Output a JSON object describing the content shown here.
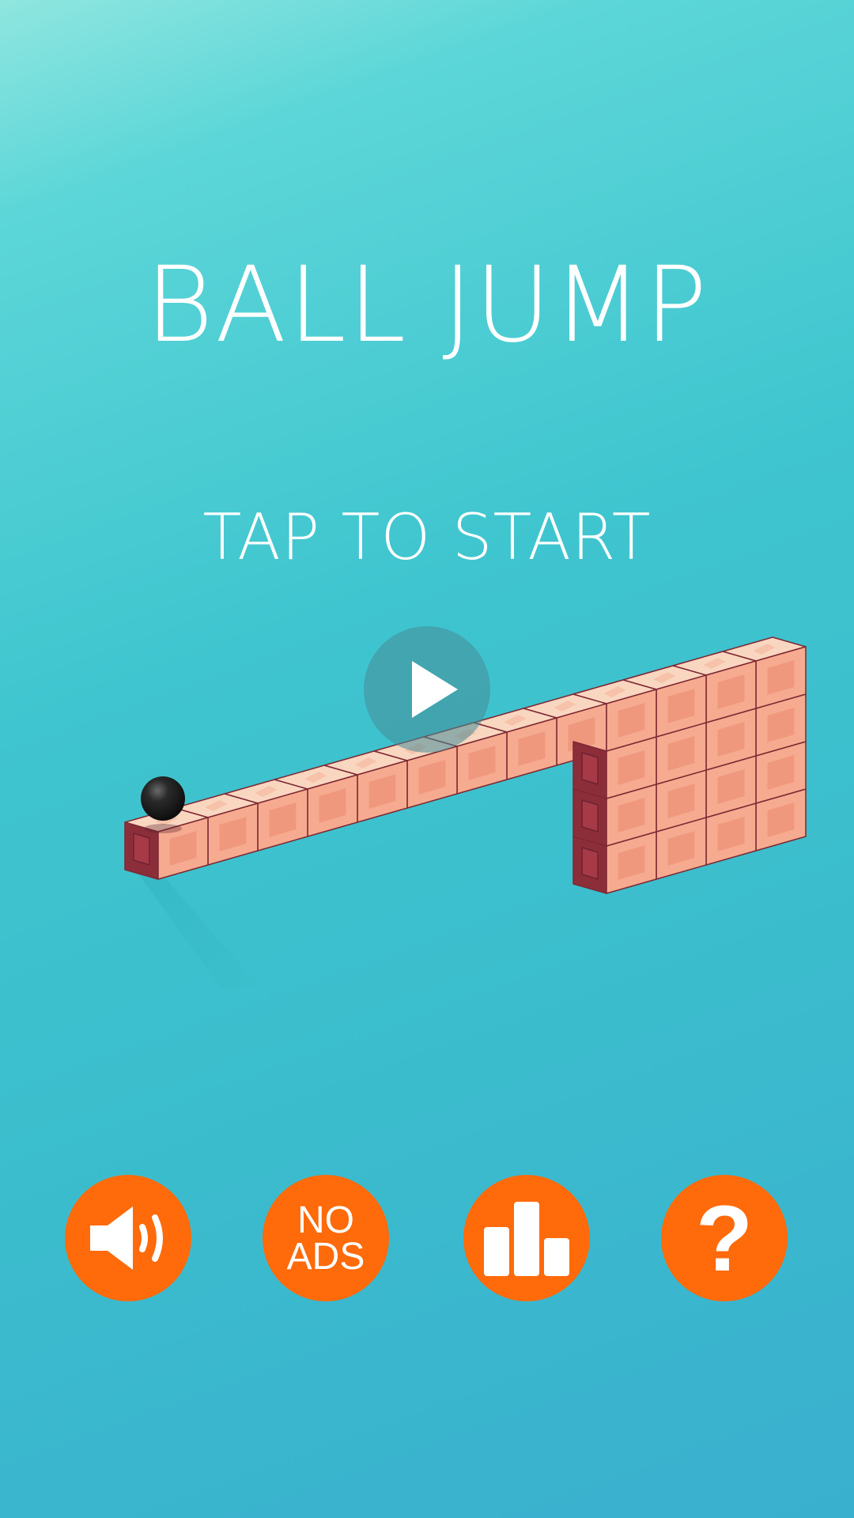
{
  "game": {
    "title": "BALL JUMP",
    "prompt": "TAP TO START"
  },
  "play_button": {
    "icon": "play-icon"
  },
  "buttons": {
    "sound": {
      "icon": "speaker-sound-icon"
    },
    "no_ads": {
      "line1": "NO",
      "line2": "ADS"
    },
    "leaderboard": {
      "icon": "podium-icon"
    },
    "help": {
      "glyph": "?"
    }
  },
  "colors": {
    "accent_button": "#ff6a0a",
    "block_top": "#f9d6c0",
    "block_front": "#f6ab90",
    "block_side": "#8c2e3a",
    "ball": "#1c1c1c"
  }
}
